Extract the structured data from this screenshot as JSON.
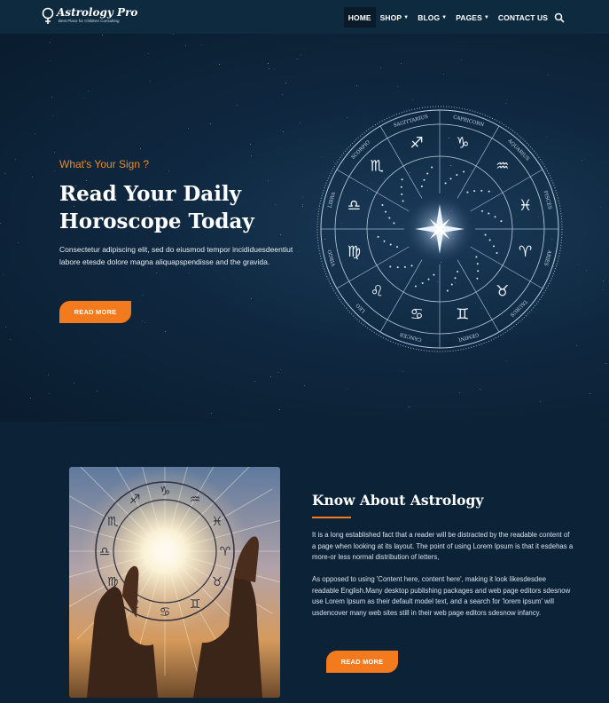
{
  "brand": {
    "name": "Astrology Pro",
    "tagline": "Best Place for Children Consulting"
  },
  "nav": {
    "items": [
      {
        "label": "HOME",
        "active": true,
        "dropdown": false
      },
      {
        "label": "SHOP",
        "active": false,
        "dropdown": true
      },
      {
        "label": "BLOG",
        "active": false,
        "dropdown": true
      },
      {
        "label": "PAGES",
        "active": false,
        "dropdown": true
      },
      {
        "label": "CONTACT US",
        "active": false,
        "dropdown": false
      }
    ],
    "search_icon": "search-icon"
  },
  "hero": {
    "kicker": "What's Your Sign ?",
    "title": "Read Your Daily Horoscope Today",
    "text": "Consectetur adipiscing elit, sed do eiusmod tempor incididuesdeentiut labore etesde dolore magna aliquapspendisse and the gravida.",
    "button": "READ MORE",
    "zodiac_signs": [
      "CAPRICORN",
      "AQUARIUS",
      "PISCES",
      "ARIES",
      "TAURUS",
      "GEMINI",
      "CANCER",
      "LEO",
      "VIRGO",
      "LIBRA",
      "SCORPIO",
      "SAGITTARIUS"
    ]
  },
  "about": {
    "title": "Know About Astrology",
    "p1": "It is a long established fact that a reader will be distracted by the readable content of a page when looking at its layout. The point of using Lorem Ipsum is that it esdehas a more-or less normal distribution of letters,",
    "p2": "As opposed to using 'Content here, content here', making it look likesdesdee readable English.Many desktop publishing packages and web page editors sdesnow use Lorem Ipsum as their default model text, and a search for 'lorem ipsum' will usdencover many web sites still in their web page editors sdesnow infancy.",
    "button": "READ MORE"
  },
  "colors": {
    "accent": "#f47a1e",
    "navy": "#0d2236",
    "nav_bg": "#0e2a3f"
  }
}
